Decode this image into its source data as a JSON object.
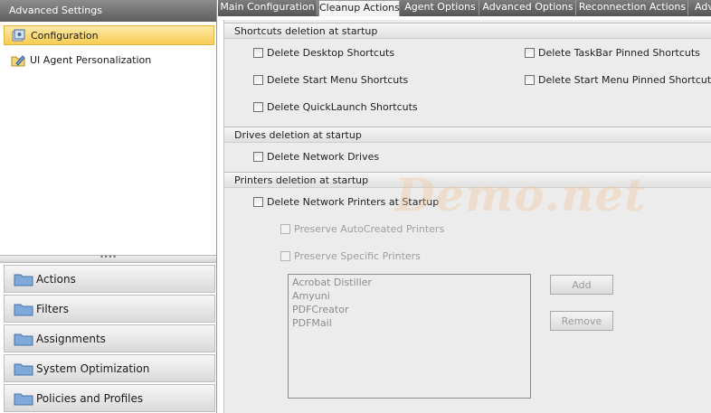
{
  "left_panel": {
    "header": "Advanced Settings",
    "tree": [
      {
        "label": "Configuration",
        "icon": "configuration-icon",
        "selected": true
      },
      {
        "label": "UI Agent Personalization",
        "icon": "personalization-icon",
        "selected": false
      }
    ],
    "splitter_grip": "••••",
    "nav": [
      {
        "label": "Actions",
        "icon": "folder-icon"
      },
      {
        "label": "Filters",
        "icon": "folder-icon"
      },
      {
        "label": "Assignments",
        "icon": "folder-icon"
      },
      {
        "label": "System Optimization",
        "icon": "folder-icon"
      },
      {
        "label": "Policies and Profiles",
        "icon": "folder-icon"
      }
    ]
  },
  "tabs": [
    {
      "label": "Main Configuration",
      "active": false
    },
    {
      "label": "Cleanup Actions",
      "active": true
    },
    {
      "label": "Agent Options",
      "active": false
    },
    {
      "label": "Advanced Options",
      "active": false
    },
    {
      "label": "Reconnection Actions",
      "active": false
    },
    {
      "label": "Adv",
      "active": false
    }
  ],
  "sections": {
    "shortcuts": {
      "title": "Shortcuts deletion at startup",
      "options": {
        "desktop": {
          "label": "Delete Desktop Shortcuts",
          "checked": false
        },
        "start_menu": {
          "label": "Delete Start Menu Shortcuts",
          "checked": false
        },
        "quicklaunch": {
          "label": "Delete QuickLaunch Shortcuts",
          "checked": false
        },
        "taskbar_pinned": {
          "label": "Delete TaskBar Pinned Shortcuts",
          "checked": false
        },
        "start_menu_pinned": {
          "label": "Delete Start Menu Pinned Shortcuts",
          "checked": false
        }
      }
    },
    "drives": {
      "title": "Drives deletion at startup",
      "options": {
        "network_drives": {
          "label": "Delete Network Drives",
          "checked": false
        }
      }
    },
    "printers": {
      "title": "Printers deletion at startup",
      "options": {
        "network_printers": {
          "label": "Delete Network Printers at Startup",
          "checked": false
        },
        "preserve_autocreated": {
          "label": "Preserve AutoCreated Printers",
          "checked": false,
          "disabled": true
        },
        "preserve_specific": {
          "label": "Preserve Specific Printers",
          "checked": false,
          "disabled": true
        }
      },
      "printer_list": [
        "Acrobat Distiller",
        "Amyuni",
        "PDFCreator",
        "PDFMail"
      ],
      "add_button": "Add",
      "remove_button": "Remove"
    }
  },
  "watermark": "Demo.net",
  "colors": {
    "selected_item_bg": "#f8cc55",
    "header_bg": "#5e5e5e",
    "panel_bg": "#ececec"
  }
}
